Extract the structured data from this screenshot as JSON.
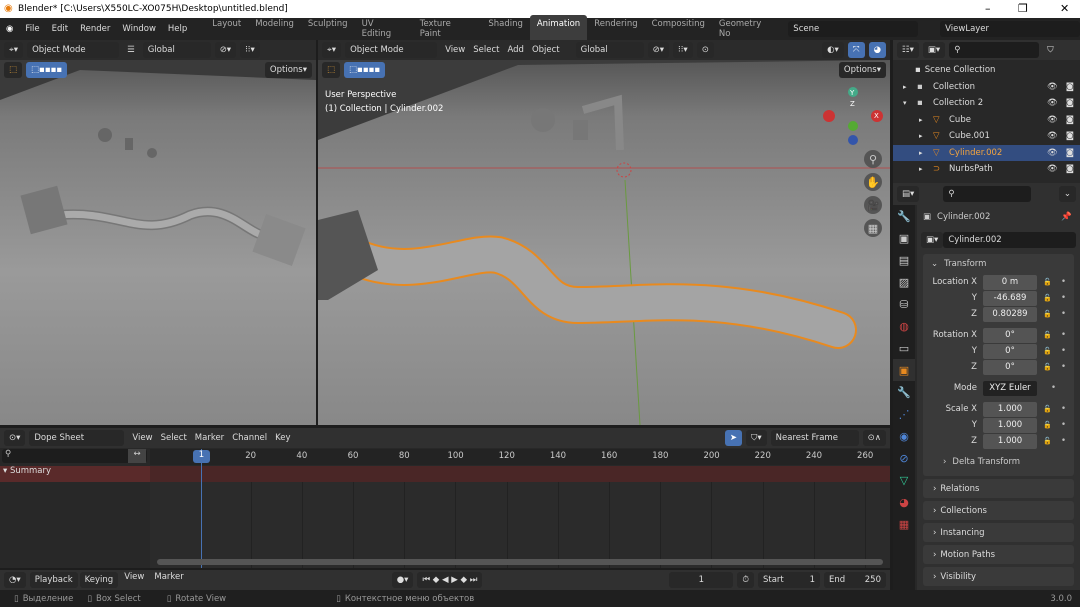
{
  "window": {
    "title": "Blender* [C:\\Users\\X550LC-XO075H\\Desktop\\untitled.blend]",
    "minimize": "–",
    "maximize": "❐",
    "close": "✕"
  },
  "menu": [
    "File",
    "Edit",
    "Render",
    "Window",
    "Help"
  ],
  "workspaces": [
    "Layout",
    "Modeling",
    "Sculpting",
    "UV Editing",
    "Texture Paint",
    "Shading",
    "Animation",
    "Rendering",
    "Compositing",
    "Geometry No"
  ],
  "active_workspace": "Animation",
  "scene": "Scene",
  "view_layer": "ViewLayer",
  "left_viewport": {
    "mode": "Object Mode",
    "orientation": "Global",
    "options": "Options"
  },
  "right_viewport": {
    "mode": "Object Mode",
    "menus": [
      "View",
      "Select",
      "Add",
      "Object"
    ],
    "orientation": "Global",
    "options": "Options",
    "perspective": "User Perspective",
    "context": "(1) Collection | Cylinder.002",
    "axes": {
      "x": "X",
      "y": "Y",
      "z": "Z"
    }
  },
  "outliner": {
    "root": "Scene Collection",
    "items": [
      {
        "name": "Collection",
        "level": 0,
        "expand": "▸"
      },
      {
        "name": "Collection 2",
        "level": 0,
        "expand": "▾"
      },
      {
        "name": "Cube",
        "level": 1,
        "expand": "▸"
      },
      {
        "name": "Cube.001",
        "level": 1,
        "expand": "▸"
      },
      {
        "name": "Cylinder.002",
        "level": 1,
        "expand": "▸",
        "selected": true
      },
      {
        "name": "NurbsPath",
        "level": 1,
        "expand": "▸"
      }
    ]
  },
  "properties": {
    "object_name": "Cylinder.002",
    "data_name": "Cylinder.002",
    "transform": "Transform",
    "location": {
      "label": "Location X",
      "x": "0 m",
      "y": "-46.689",
      "z": "0.80289"
    },
    "rotation": {
      "label": "Rotation X",
      "x": "0°",
      "y": "0°",
      "z": "0°"
    },
    "mode_label": "Mode",
    "mode": "XYZ Euler",
    "scale": {
      "label": "Scale X",
      "x": "1.000",
      "y": "1.000",
      "z": "1.000"
    },
    "y": "Y",
    "z": "Z",
    "delta": "Delta Transform",
    "sections": [
      "Relations",
      "Collections",
      "Instancing",
      "Motion Paths",
      "Visibility"
    ]
  },
  "dopesheet": {
    "mode": "Dope Sheet",
    "menus": [
      "View",
      "Select",
      "Marker",
      "Channel",
      "Key"
    ],
    "snap": "Nearest Frame",
    "current_frame": "1",
    "ticks": [
      "20",
      "40",
      "60",
      "80",
      "100",
      "120",
      "140",
      "160",
      "180",
      "200",
      "220",
      "240",
      "260"
    ],
    "summary": "Summary"
  },
  "timeline": {
    "menus": [
      "Playback",
      "Keying",
      "View",
      "Marker"
    ],
    "frame": "1",
    "start_label": "Start",
    "start": "1",
    "end_label": "End",
    "end": "250"
  },
  "status": {
    "items": [
      "Выделение",
      "Box Select",
      "Rotate View",
      "Контекстное меню объектов"
    ],
    "version": "3.0.0"
  },
  "colors": {
    "accent": "#4772b3",
    "selection": "#e88a1f",
    "header": "#303030"
  }
}
